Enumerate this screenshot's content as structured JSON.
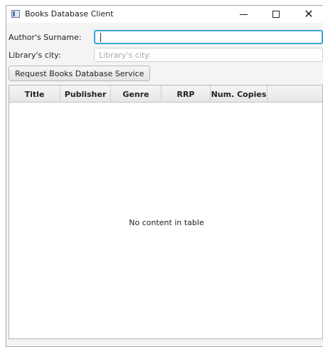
{
  "window": {
    "title": "Books Database Client"
  },
  "form": {
    "author_label": "Author's Surname:",
    "author_value": "",
    "city_label": "Library's city:",
    "city_placeholder": "Library's city:",
    "request_button": "Request Books Database Service"
  },
  "table": {
    "columns": [
      "Title",
      "Publisher",
      "Genre",
      "RRP",
      "Num. Copies"
    ],
    "empty_message": "No content in table"
  },
  "colors": {
    "focus_border": "#3aa6d6"
  }
}
